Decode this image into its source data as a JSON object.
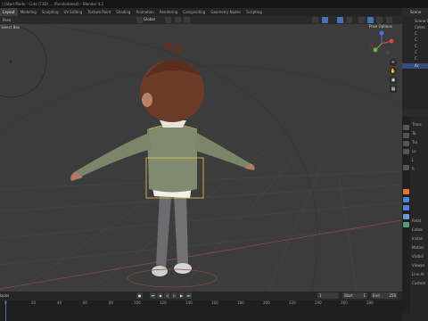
{
  "window": {
    "title": "] (Start Mode - Cute (T3D) ... (Renderbleed) - Blender 4.2"
  },
  "workspaces": [
    "Layout",
    "Modeling",
    "Sculpting",
    "UV Editing",
    "Texture Paint",
    "Shading",
    "Animation",
    "Rendering",
    "Compositing",
    "Geometry Nodes",
    "Scripting"
  ],
  "header": {
    "mode": "Pose",
    "select_box": "Select Box",
    "transform_orientation": "Global"
  },
  "viewport": {
    "pose_options": "Pose Options"
  },
  "outliner": {
    "title": "Scene",
    "rows": [
      "Scene Col",
      "Collec",
      "C",
      "C",
      "C",
      "C",
      "C",
      "Ar"
    ]
  },
  "properties": {
    "rows": [
      "Trans",
      "Ta",
      "Tra",
      "Lo",
      "L",
      "R",
      "Relat",
      "Collec",
      "Instan",
      "Motion",
      "Visibili",
      "Viewpo",
      "Line Ar",
      "Custom"
    ]
  },
  "timeline": {
    "playback_label": "lacks",
    "current_frame": "1",
    "start_label": "Start",
    "start_value": "1",
    "end_label": "End",
    "end_value": "250",
    "ticks": [
      "0",
      "20",
      "40",
      "60",
      "80",
      "100",
      "120",
      "140",
      "160",
      "180",
      "200",
      "220",
      "240",
      "260",
      "280"
    ]
  },
  "colors": {
    "accent_blue": "#4772b3",
    "selection_yellow": "#e8c84a",
    "outliner_selected": "#334d80"
  },
  "icons": {
    "play": "play-icon",
    "jump_start": "jump-start-icon",
    "jump_end": "jump-end-icon",
    "zoom": "zoom-icon",
    "pan": "hand-icon",
    "camera": "camera-icon",
    "ortho": "grid-icon"
  }
}
